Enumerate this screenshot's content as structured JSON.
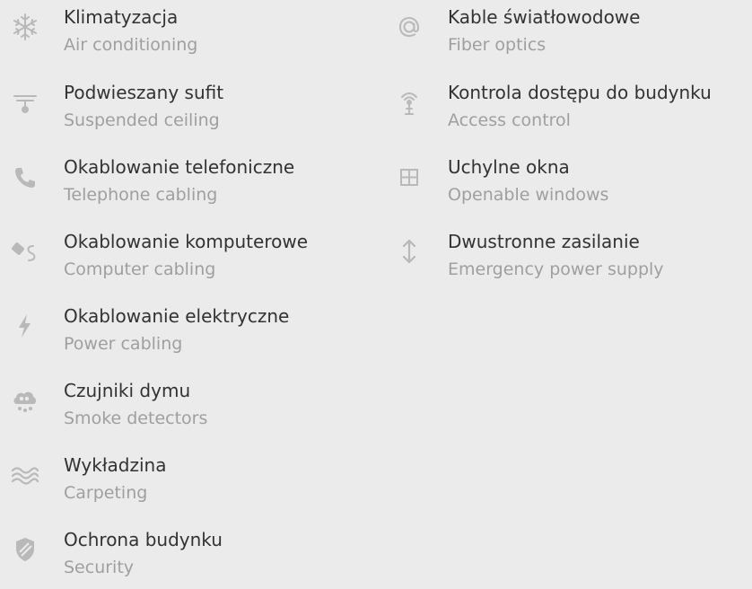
{
  "amenities": [
    {
      "key": "air",
      "title_pl": "Klimatyzacja",
      "title_en": "Air conditioning",
      "icon": "snowflake-icon"
    },
    {
      "key": "ceiling",
      "title_pl": "Podwieszany sufit",
      "title_en": "Suspended ceiling",
      "icon": "ceiling-icon"
    },
    {
      "key": "phone",
      "title_pl": "Okablowanie telefoniczne",
      "title_en": "Telephone cabling",
      "icon": "phone-icon"
    },
    {
      "key": "computer",
      "title_pl": "Okablowanie komputerowe",
      "title_en": "Computer cabling",
      "icon": "cable-icon"
    },
    {
      "key": "power",
      "title_pl": "Okablowanie elektryczne",
      "title_en": "Power cabling",
      "icon": "lightning-icon"
    },
    {
      "key": "smoke",
      "title_pl": "Czujniki dymu",
      "title_en": "Smoke detectors",
      "icon": "smoke-icon"
    },
    {
      "key": "carpet",
      "title_pl": "Wykładzina",
      "title_en": "Carpeting",
      "icon": "waves-icon"
    },
    {
      "key": "security",
      "title_pl": "Ochrona budynku",
      "title_en": "Security",
      "icon": "shield-icon"
    },
    {
      "key": "fiber",
      "title_pl": "Kable światłowodowe",
      "title_en": "Fiber optics",
      "icon": "at-icon"
    },
    {
      "key": "access",
      "title_pl": "Kontrola dostępu do budynku",
      "title_en": "Access control",
      "icon": "antenna-icon"
    },
    {
      "key": "windows",
      "title_pl": "Uchylne okna",
      "title_en": "Openable windows",
      "icon": "window-icon"
    },
    {
      "key": "emergency",
      "title_pl": "Dwustronne zasilanie",
      "title_en": "Emergency power supply",
      "icon": "updown-arrow-icon"
    }
  ],
  "colors": {
    "background": "#ebebeb",
    "icon": "#b9b9b9",
    "title_pl": "#323232",
    "title_en": "#9f9f9f"
  }
}
